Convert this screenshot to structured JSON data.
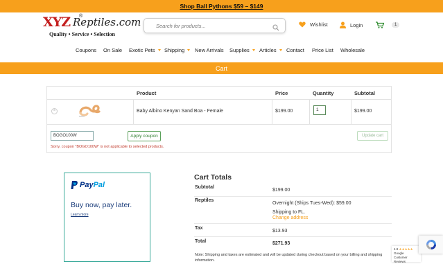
{
  "promo": {
    "text": "Shop Ball Pythons $59 – $149"
  },
  "logo": {
    "xyz": "XYZ",
    "reptiles": "Reptiles.com",
    "reg": "®",
    "tagline": "Quality  •  Service  •  Selection"
  },
  "search": {
    "placeholder": "Search for products..."
  },
  "header": {
    "wishlist": "Wishlist",
    "login": "Login",
    "cart_count": "1"
  },
  "nav": {
    "items": [
      {
        "label": "Coupons",
        "dropdown": false
      },
      {
        "label": "On Sale",
        "dropdown": false
      },
      {
        "label": "Exotic Pets",
        "dropdown": true
      },
      {
        "label": "Shipping",
        "dropdown": true
      },
      {
        "label": "New Arrivals",
        "dropdown": false
      },
      {
        "label": "Supplies",
        "dropdown": true
      },
      {
        "label": "Articles",
        "dropdown": true
      },
      {
        "label": "Contact",
        "dropdown": false
      },
      {
        "label": "Price List",
        "dropdown": false
      },
      {
        "label": "Wholesale",
        "dropdown": false
      }
    ]
  },
  "page": {
    "title": "Cart"
  },
  "cart": {
    "columns": {
      "product": "Product",
      "price": "Price",
      "quantity": "Quantity",
      "subtotal": "Subtotal"
    },
    "items": [
      {
        "name": "Baby Albino Kenyan Sand Boa - Female",
        "price": "$199.00",
        "quantity": "1",
        "subtotal": "$199.00"
      }
    ],
    "coupon_code": "BOGO100W",
    "apply_label": "Apply coupon",
    "update_label": "Update cart",
    "error": "Sorry, coupon \"BOGO100W\" is not applicable to selected products."
  },
  "paypal": {
    "brand_pay": "Pay",
    "brand_pal": "Pal",
    "headline": "Buy now, pay later.",
    "learn_more": "Learn more"
  },
  "totals": {
    "title": "Cart Totals",
    "subtotal_label": "Subtotal",
    "subtotal": "$199.00",
    "shipping_label": "Reptiles",
    "shipping_method": "Overnight (Ships Tues-Wed): $59.00",
    "shipping_to": "Shipping to FL.",
    "change_address": "Change address",
    "tax_label": "Tax",
    "tax": "$13.93",
    "total_label": "Total",
    "total": "$271.93",
    "note": "Note: Shipping and taxes are estimated and will be updated during checkout based on your billing and shipping information."
  },
  "reviews": {
    "rating": "4.9",
    "stars": "★★★★★",
    "line1": "Google",
    "line2": "Customer Reviews"
  },
  "colors": {
    "accent": "#f7a01c",
    "paypal_dark": "#003087",
    "paypal_light": "#009cde",
    "error": "#c0392b"
  }
}
